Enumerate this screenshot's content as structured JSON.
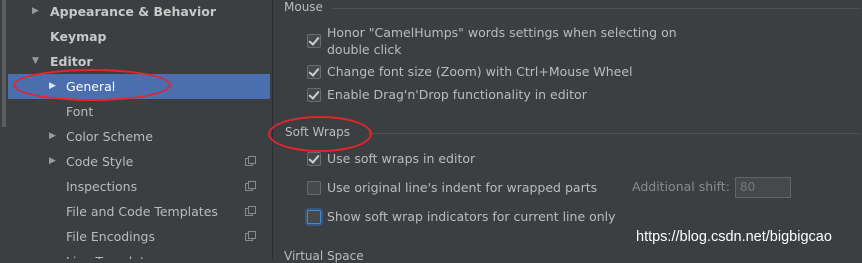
{
  "sidebar": {
    "items": [
      {
        "label": "Appearance & Behavior",
        "arrow": "▶",
        "bold": true
      },
      {
        "label": "Keymap",
        "arrow": "",
        "bold": true
      },
      {
        "label": "Editor",
        "arrow": "▼",
        "bold": true
      },
      {
        "label": "General",
        "arrow": "▶",
        "selected": true
      },
      {
        "label": "Font",
        "arrow": ""
      },
      {
        "label": "Color Scheme",
        "arrow": "▶"
      },
      {
        "label": "Code Style",
        "arrow": "▶",
        "project_icon": "copy-icon"
      },
      {
        "label": "Inspections",
        "arrow": "",
        "project_icon": "copy-icon"
      },
      {
        "label": "File and Code Templates",
        "arrow": "",
        "project_icon": "copy-icon"
      },
      {
        "label": "File Encodings",
        "arrow": "",
        "project_icon": "copy-icon"
      },
      {
        "label": "Live Templates",
        "arrow": ""
      }
    ]
  },
  "sections": {
    "mouse": {
      "title": "Mouse",
      "options": [
        {
          "label_line1": "Honor \"CamelHumps\" words settings when selecting on",
          "label_line2": "double click",
          "checked": true
        },
        {
          "label": "Change font size (Zoom) with Ctrl+Mouse Wheel",
          "checked": true
        },
        {
          "label": "Enable Drag'n'Drop functionality in editor",
          "checked": true
        }
      ]
    },
    "soft_wraps": {
      "title": "Soft Wraps",
      "options": [
        {
          "label": "Use soft wraps in editor",
          "checked": true
        },
        {
          "label": "Use original line's indent for wrapped parts",
          "checked": false
        },
        {
          "label": "Show soft wrap indicators for current line only",
          "checked": false,
          "focused": true
        }
      ],
      "additional_shift_label": "Additional shift:",
      "additional_shift_value": "80"
    },
    "virtual_space": {
      "title": "Virtual Space"
    }
  },
  "watermark": "https://blog.csdn.net/bigbigcao",
  "colors": {
    "background": "#3c3f41",
    "selection": "#4b6eaf",
    "annotation_red": "#e8232a"
  }
}
